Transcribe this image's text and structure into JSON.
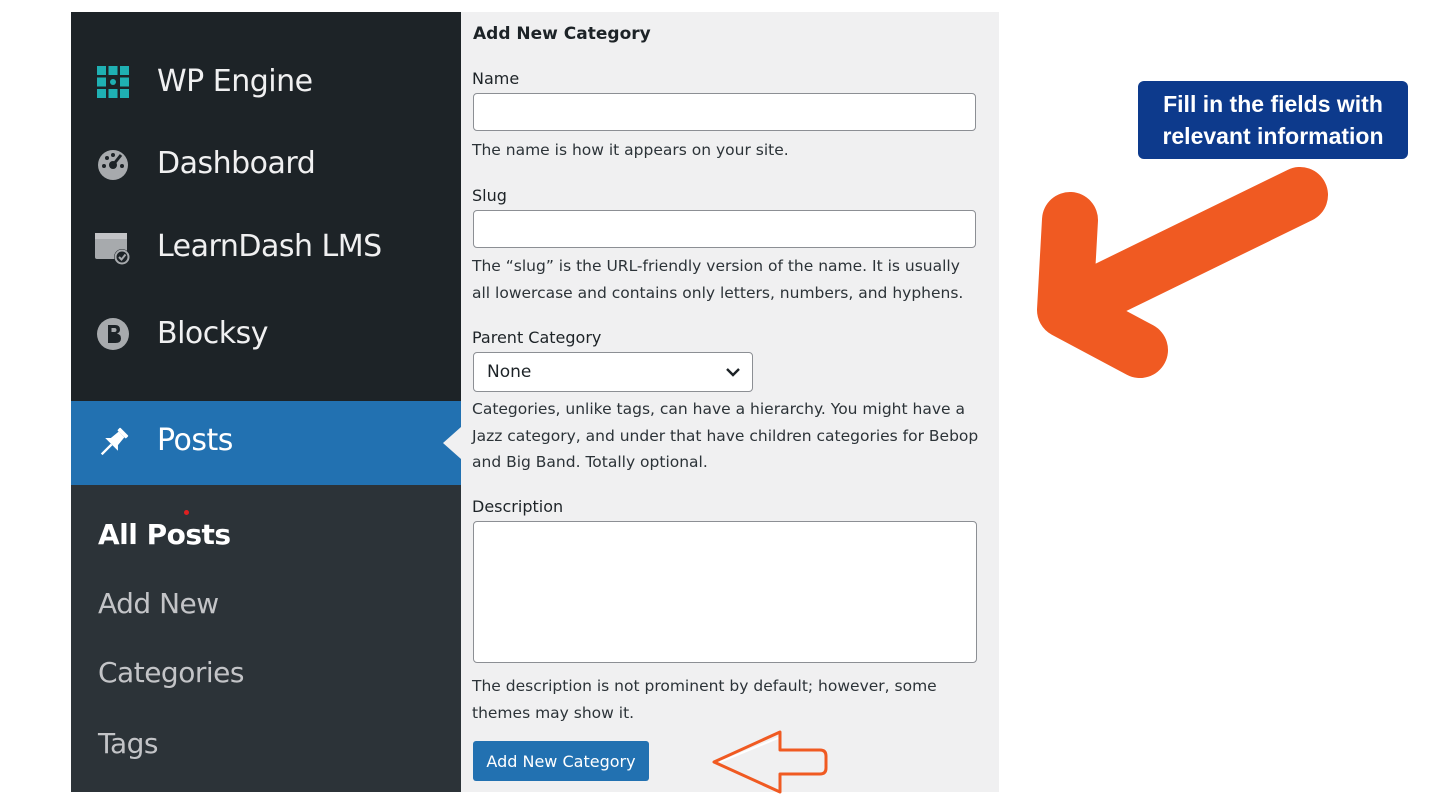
{
  "sidebar": {
    "items": [
      {
        "label": "WP Engine",
        "icon": "wp-engine-icon"
      },
      {
        "label": "Dashboard",
        "icon": "dashboard-gauge-icon"
      },
      {
        "label": "LearnDash LMS",
        "icon": "learndash-icon"
      },
      {
        "label": "Blocksy",
        "icon": "blocksy-icon"
      }
    ],
    "active": {
      "label": "Posts",
      "icon": "pin-icon"
    },
    "submenu": [
      {
        "label": "All Posts",
        "current": true
      },
      {
        "label": "Add New"
      },
      {
        "label": "Categories"
      },
      {
        "label": "Tags"
      }
    ]
  },
  "form": {
    "title": "Add New Category",
    "name_label": "Name",
    "name_value": "",
    "name_help": "The name is how it appears on your site.",
    "slug_label": "Slug",
    "slug_value": "",
    "slug_help": "The “slug” is the URL-friendly version of the name. It is usually all lowercase and contains only letters, numbers, and hyphens.",
    "parent_label": "Parent Category",
    "parent_value": "None",
    "parent_help": "Categories, unlike tags, can have a hierarchy. You might have a Jazz category, and under that have children categories for Bebop and Big Band. Totally optional.",
    "description_label": "Description",
    "description_value": "",
    "description_help": "The description is not prominent by default; however, some themes may show it.",
    "submit_label": "Add New Category"
  },
  "callout": {
    "text": "Fill in the fields with relevant information"
  },
  "colors": {
    "sidebar_bg": "#1d2327",
    "submenu_bg": "#2c3338",
    "active_bg": "#2271b1",
    "panel_bg": "#f0f0f1",
    "callout_bg": "#0d3a8c",
    "arrow": "#f05a22"
  }
}
